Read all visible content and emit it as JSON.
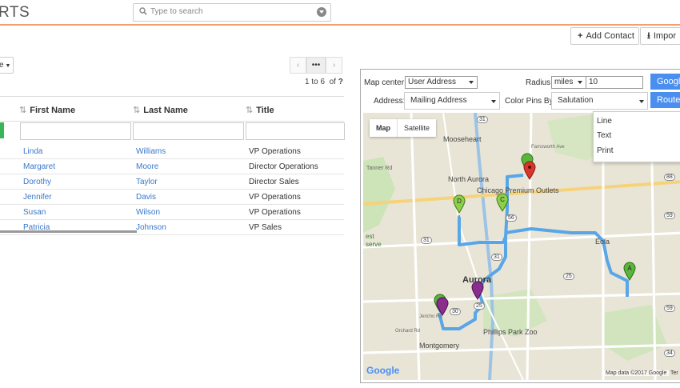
{
  "app": {
    "logo_text": "RTS"
  },
  "search": {
    "placeholder": "Type to search"
  },
  "toolbar": {
    "add_contact_label": "Add Contact",
    "import_label": "Impor"
  },
  "view": {
    "selected": "e"
  },
  "pager": {
    "prev": "‹",
    "dots": "•••",
    "next": "›",
    "info_prefix": "1 to 6",
    "info_of": "of",
    "info_total": "?"
  },
  "table": {
    "columns": [
      "First Name",
      "Last Name",
      "Title"
    ],
    "rows": [
      {
        "first": "Linda",
        "last": "Williams",
        "title": "VP Operations"
      },
      {
        "first": "Margaret",
        "last": "Moore",
        "title": "Director Operations"
      },
      {
        "first": "Dorothy",
        "last": "Taylor",
        "title": "Director Sales"
      },
      {
        "first": "Jennifer",
        "last": "Davis",
        "title": "VP Operations"
      },
      {
        "first": "Susan",
        "last": "Wilson",
        "title": "VP Operations"
      },
      {
        "first": "Patricia",
        "last": "Johnson",
        "title": "VP Sales"
      }
    ]
  },
  "map_panel": {
    "center_label": "Map center:",
    "center_value": "User Address",
    "radius_label": "Radius:",
    "radius_unit": "miles",
    "radius_value": "10",
    "google_label": "Google",
    "address_label": "Address:",
    "address_value": "Mailing Address",
    "color_label": "Color Pins By:",
    "color_value": "Salutation",
    "route_label": "Route",
    "maptype_map": "Map",
    "maptype_satellite": "Satellite",
    "menu_items": [
      "Line",
      "Text",
      "Print"
    ],
    "attribution": "Map data ©2017 Google",
    "terms": "Ter",
    "google_logo": "Google"
  },
  "map_labels": {
    "mooseheart": "Mooseheart",
    "north_aurora": "North Aurora",
    "chicago_outlets": "Chicago Premium Outlets",
    "aurora": "Aurora",
    "phillips_park": "Phillips Park Zoo",
    "montgomery": "Montgomery",
    "eola": "Eola",
    "tanner": "Tanner Rd",
    "orchard": "Orchard Rd",
    "farnsworth": "Farnsworth Ave",
    "jericho": "Jericho Rd",
    "est": "est",
    "serve": "serve",
    "pins": [
      "D",
      "C",
      "A"
    ],
    "routes": [
      "31",
      "56",
      "25",
      "30",
      "31",
      "59",
      "59",
      "25",
      "31",
      "88",
      "34"
    ]
  },
  "colors": {
    "accent": "#f0a070",
    "link": "#3a77c9",
    "button_blue": "#4a8ef0",
    "route": "#58a6e8",
    "pin_green": "#5bb53b",
    "pin_red": "#d9362b",
    "pin_purple": "#8a2d8f"
  }
}
